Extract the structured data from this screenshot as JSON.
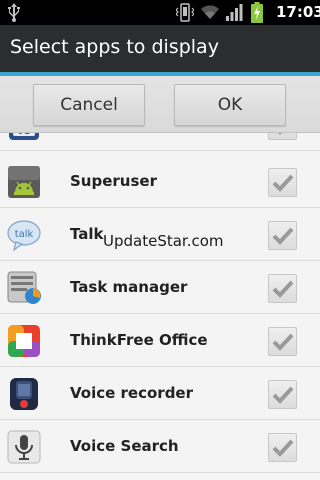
{
  "status_bar": {
    "time": "17:03",
    "icons": [
      "usb-icon",
      "vibrate-icon",
      "wifi-icon",
      "signal-icon",
      "battery-charging-icon"
    ]
  },
  "dialog": {
    "title": "Select apps to display",
    "cancel_label": "Cancel",
    "ok_label": "OK"
  },
  "apps": [
    {
      "label": "",
      "icon": "partial-app-icon",
      "checked": true
    },
    {
      "label": "Superuser",
      "icon": "android-icon",
      "checked": true
    },
    {
      "label": "Talk",
      "icon": "talk-icon",
      "checked": true
    },
    {
      "label": "Task manager",
      "icon": "task-manager-icon",
      "checked": true
    },
    {
      "label": "ThinkFree Office",
      "icon": "thinkfree-icon",
      "checked": true
    },
    {
      "label": "Voice recorder",
      "icon": "recorder-icon",
      "checked": true
    },
    {
      "label": "Voice Search",
      "icon": "microphone-icon",
      "checked": true
    }
  ],
  "watermark": "UpdateStar.com",
  "colors": {
    "accent": "#3ba7d5",
    "title_bg": "#2c2d2f",
    "list_bg": "#f4f4f4"
  }
}
